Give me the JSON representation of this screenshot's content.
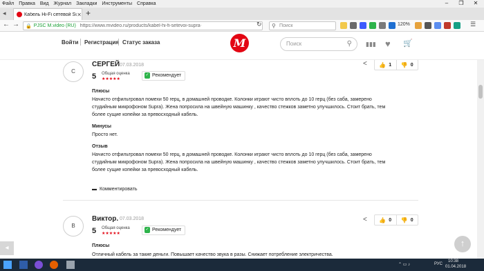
{
  "browser": {
    "menu": [
      "Файл",
      "Правка",
      "Вид",
      "Журнал",
      "Закладки",
      "Инструменты",
      "Справка"
    ],
    "window_controls": [
      "–",
      "❐",
      "✕"
    ],
    "tab": {
      "title": "Кабель Hi-Fi сетевой Supra Lo",
      "close": "✕"
    },
    "new_tab": "+",
    "tab_list": "◂",
    "back": "←",
    "forward": "→",
    "lock": "🔒",
    "site_identity": "PJSC M.video (RU)",
    "url": "https://www.mvideo.ru/products/kabel-hi-fi-setevoi-supra-lorad",
    "reload": "↻",
    "search_placeholder": "Поиск",
    "search_icon": "⚲",
    "zoom": "120%",
    "menu_icon": "☰"
  },
  "site": {
    "nav": [
      "Войти",
      "Регистрация",
      "Статус заказа"
    ],
    "logo": "M",
    "search_placeholder": "Поиск",
    "search_icon": "⚲",
    "icons": {
      "compare": "▮▮▮",
      "favorites": "♥",
      "cart": "🛒"
    }
  },
  "reviews": [
    {
      "initial": "С",
      "name": "СЕРГЕЙ",
      "date": "07.03.2018",
      "score": "5",
      "overall_label": "Общая оценка",
      "stars": "★★★★★",
      "recommend": "Рекомендует",
      "share_icon": "<",
      "likes": "1",
      "dislikes": "0",
      "pros_title": "Плюсы",
      "pros_text": "Начисто отфильтровал помехи 50 герц, в домашней проводке. Колонки играют чисто вплоть до 10 герц (без саба, замерено студийным микрофоном Supra). Жена попросила на швейную машинку , качество стежков заметно улучшилось. Стоит брать, тем более сущие копейки за превосходный кабель.",
      "cons_title": "Минусы",
      "cons_text": "Просто нет.",
      "review_title": "Отзыв",
      "review_text": "Начисто отфильтровал помехи 50 герц, в домашней проводке. Колонки играют чисто вплоть до 10 герц (без саба, замерено студийным микрофоном Supra). Жена попросила на швейную машинку , качество стежков заметно улучшилось. Стоит брать, тем более сущие копейки за превосходный кабель.",
      "comment_label": "Комментировать"
    },
    {
      "initial": "В",
      "name": "Виктор.",
      "date": "07.03.2018",
      "score": "5",
      "overall_label": "Общая оценка",
      "stars": "★★★★★",
      "recommend": "Рекомендует",
      "share_icon": "<",
      "likes": "0",
      "dislikes": "0",
      "pros_title": "Плюсы",
      "pros_text": "Отличный кабель за такие деньги. Повышает качество звука в разы. Снижает потребление электричества."
    }
  ],
  "scroll_to_top": "↑",
  "prev_arrow": "◂",
  "taskbar": {
    "lang": "РУС",
    "time": "10:38",
    "date": "01.04.2018",
    "tray_icons": "⌃ ▭ ♪"
  }
}
